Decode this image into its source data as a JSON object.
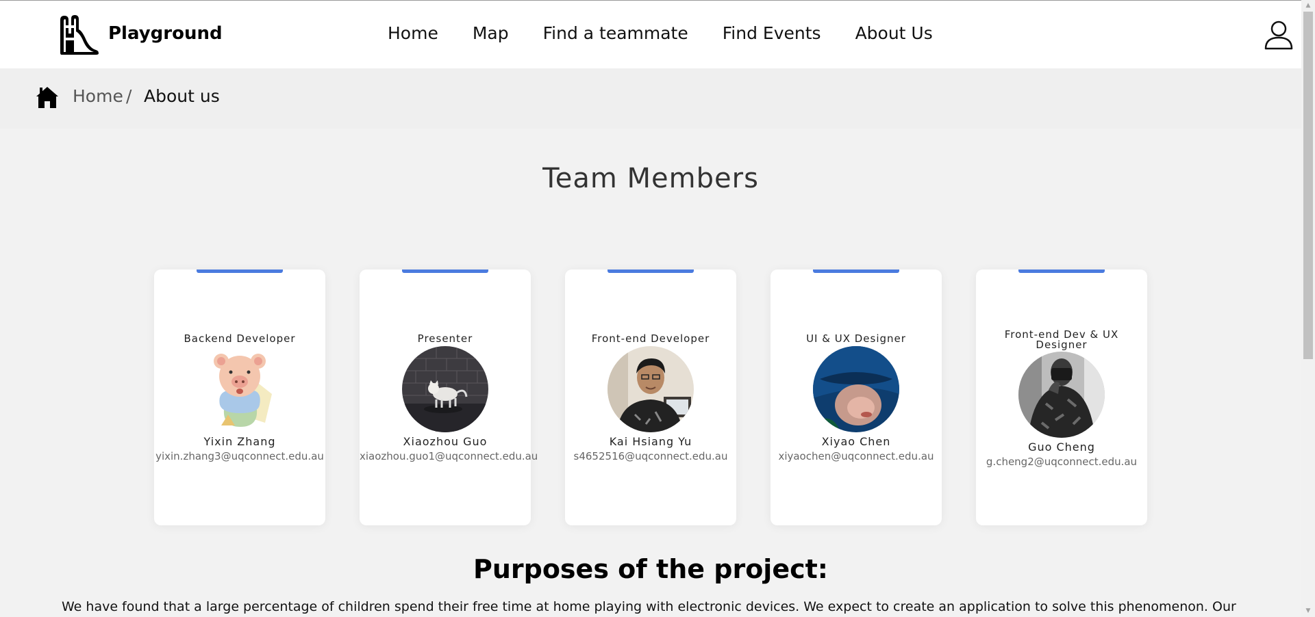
{
  "header": {
    "brand": "Playground",
    "nav": [
      "Home",
      "Map",
      "Find a teammate",
      "Find Events",
      "About Us"
    ]
  },
  "breadcrumb": {
    "home": "Home",
    "separator": "/",
    "current": "About us"
  },
  "team": {
    "title": "Team Members",
    "members": [
      {
        "role": "Backend Developer",
        "name": "Yixin Zhang",
        "email": "yixin.zhang3@uqconnect.edu.au",
        "avatar": "cartoon-pig-avatar"
      },
      {
        "role": "Presenter",
        "name": "Xiaozhou Guo",
        "email": "xiaozhou.guo1@uqconnect.edu.au",
        "avatar": "cat-photo-avatar"
      },
      {
        "role": "Front-end Developer",
        "name": "Kai Hsiang Yu",
        "email": "s4652516@uqconnect.edu.au",
        "avatar": "person-photo-avatar"
      },
      {
        "role": "UI & UX Designer",
        "name": "Xiyao Chen",
        "email": "xiyaochen@uqconnect.edu.au",
        "avatar": "blue-hat-photo-avatar"
      },
      {
        "role": "Front-end Dev & UX Designer",
        "name": "Guo Cheng",
        "email": "g.cheng2@uqconnect.edu.au",
        "avatar": "bw-photo-avatar"
      }
    ]
  },
  "purposes": {
    "title": "Purposes of the project:",
    "text": "We have found that a large percentage of children spend their free time at home playing with electronic devices. We expect to create an application to solve this phenomenon. Our"
  },
  "colors": {
    "accent": "#4a7bdf",
    "background": "#f2f2f2"
  }
}
